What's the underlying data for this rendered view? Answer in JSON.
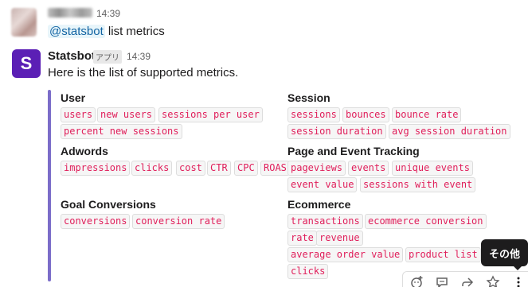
{
  "message1": {
    "time": "14:39",
    "mention": "@statsbot",
    "text": " list metrics"
  },
  "message2": {
    "avatar_letter": "S",
    "sender": "Statsbot",
    "badge": "アプリ",
    "time": "14:39",
    "text": "Here is the list of supported metrics."
  },
  "fields": {
    "user": {
      "title": "User",
      "tags": [
        "users",
        "new users",
        "sessions per user",
        "percent new sessions"
      ]
    },
    "session": {
      "title": "Session",
      "tags": [
        "sessions",
        "bounces",
        "bounce rate",
        "session duration",
        "avg session duration"
      ]
    },
    "adwords": {
      "title": "Adwords",
      "tags": [
        "impressions",
        "clicks",
        "cost",
        "CTR",
        "CPC",
        "ROAS"
      ]
    },
    "page_event": {
      "title": "Page and Event Tracking",
      "tags": [
        "pageviews",
        "events",
        "unique events",
        "event value",
        "sessions with event"
      ]
    },
    "goal": {
      "title": "Goal Conversions",
      "tags": [
        "conversions",
        "conversion rate"
      ]
    },
    "ecommerce": {
      "title": "Ecommerce",
      "tags": [
        "transactions",
        "ecommerce conversion",
        "rate",
        "revenue",
        "average order value",
        "product list",
        "clicks"
      ]
    }
  },
  "tooltip": {
    "label": "その他"
  },
  "accent_color": "#5b1fb5",
  "tag_color": "#e01e5a"
}
